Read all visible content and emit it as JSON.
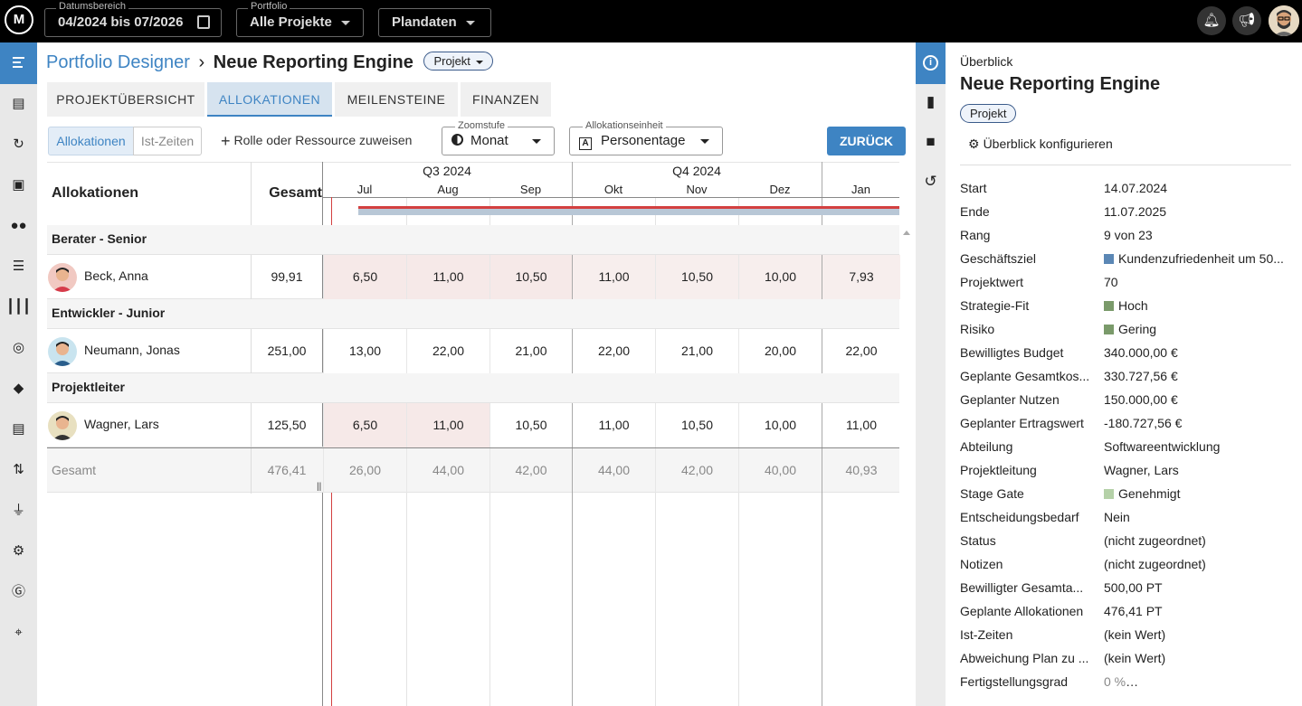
{
  "topbar": {
    "logo_text": "M",
    "date_range": {
      "label": "Datumsbereich",
      "value": "04/2024 bis 07/2026"
    },
    "portfolio": {
      "label": "Portfolio",
      "value": "Alle Projekte"
    },
    "data_mode": {
      "value": "Plandaten"
    }
  },
  "breadcrumb": {
    "parent": "Portfolio Designer",
    "separator": "›",
    "current": "Neue Reporting Engine",
    "type_chip": "Projekt"
  },
  "tabs": [
    "PROJEKTÜBERSICHT",
    "ALLOKATIONEN",
    "MEILENSTEINE",
    "FINANZEN"
  ],
  "toolbar": {
    "seg_alloc": "Allokationen",
    "seg_actual": "Ist-Zeiten",
    "assign": "Rolle oder Ressource zuweisen",
    "zoom": {
      "label": "Zoomstufe",
      "value": "Monat"
    },
    "unit": {
      "label": "Allokationseinheit",
      "value": "Personentage"
    },
    "back": "ZURÜCK"
  },
  "grid": {
    "col_alloc": "Allokationen",
    "col_total": "Gesamt",
    "quarters": [
      "Q3 2024",
      "Q4 2024"
    ],
    "months": [
      "Jul",
      "Aug",
      "Sep",
      "Okt",
      "Nov",
      "Dez",
      "Jan"
    ],
    "groups": [
      {
        "role": "Berater - Senior",
        "person": "Beck, Anna",
        "total": "99,91",
        "values": [
          "6,50",
          "11,00",
          "10,50",
          "11,00",
          "10,50",
          "10,00",
          "7,93"
        ]
      },
      {
        "role": "Entwickler - Junior",
        "person": "Neumann, Jonas",
        "total": "251,00",
        "values": [
          "13,00",
          "22,00",
          "21,00",
          "22,00",
          "21,00",
          "20,00",
          "22,00"
        ]
      },
      {
        "role": "Projektleiter",
        "person": "Wagner, Lars",
        "total": "125,50",
        "values": [
          "6,50",
          "11,00",
          "10,50",
          "11,00",
          "10,50",
          "10,00",
          "11,00"
        ]
      }
    ],
    "footer": {
      "label": "Gesamt",
      "total": "476,41",
      "values": [
        "26,00",
        "44,00",
        "42,00",
        "44,00",
        "42,00",
        "40,00",
        "40,93"
      ]
    }
  },
  "overview": {
    "heading": "Überblick",
    "title": "Neue Reporting Engine",
    "chip": "Projekt",
    "configure": "Überblick konfigurieren",
    "fields": [
      {
        "k": "Start",
        "v": "14.07.2024"
      },
      {
        "k": "Ende",
        "v": "11.07.2025"
      },
      {
        "k": "Rang",
        "v": "9 von 23"
      },
      {
        "k": "Geschäftsziel",
        "v": "Kundenzufriedenheit um 50...",
        "color": "#5b87b5"
      },
      {
        "k": "Projektwert",
        "v": "70"
      },
      {
        "k": "Strategie-Fit",
        "v": "Hoch",
        "color": "#7a9a6a"
      },
      {
        "k": "Risiko",
        "v": "Gering",
        "color": "#7a9a6a"
      },
      {
        "k": "Bewilligtes Budget",
        "v": "340.000,00 €"
      },
      {
        "k": "Geplante Gesamtkos...",
        "v": "330.727,56 €"
      },
      {
        "k": "Geplanter Nutzen",
        "v": "150.000,00 €"
      },
      {
        "k": "Geplanter Ertragswert",
        "v": "-180.727,56 €"
      },
      {
        "k": "Abteilung",
        "v": "Softwareentwicklung"
      },
      {
        "k": "Projektleitung",
        "v": "Wagner, Lars"
      },
      {
        "k": "Stage Gate",
        "v": "Genehmigt",
        "color": "#b5d1a8"
      },
      {
        "k": "Entscheidungsbedarf",
        "v": "Nein"
      },
      {
        "k": "Status",
        "v": "(nicht zugeordnet)"
      },
      {
        "k": "Notizen",
        "v": "(nicht zugeordnet)"
      },
      {
        "k": "Bewilligter Gesamta...",
        "v": "500,00 PT"
      },
      {
        "k": "Geplante Allokationen",
        "v": "476,41 PT"
      },
      {
        "k": "Ist-Zeiten",
        "v": "(kein Wert)"
      },
      {
        "k": "Abweichung Plan zu ...",
        "v": "(kein Wert)"
      },
      {
        "k": "Fertigstellungsgrad",
        "v": "0 %",
        "progress": 0
      }
    ]
  }
}
